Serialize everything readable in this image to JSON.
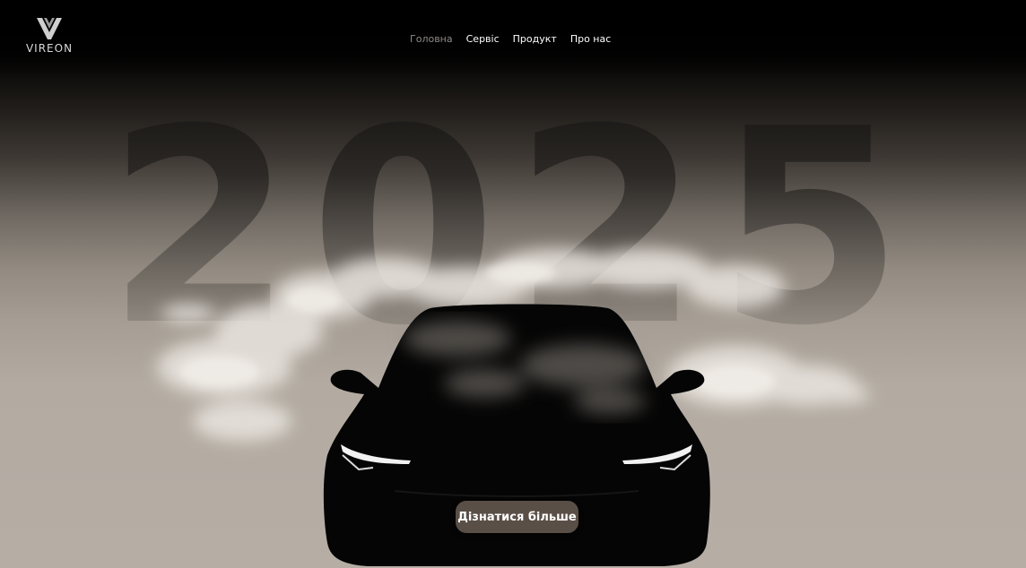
{
  "brand": {
    "name": "VIREON",
    "logo_icon": "v-logo-icon"
  },
  "nav": {
    "items": [
      {
        "label": "Головна",
        "active": true
      },
      {
        "label": "Сервіс",
        "active": false
      },
      {
        "label": "Продукт",
        "active": false
      },
      {
        "label": "Про нас",
        "active": false
      }
    ]
  },
  "hero": {
    "year": "2025",
    "cta_label": "Дізнатися більше"
  },
  "colors": {
    "background_top": "#000000",
    "background_bottom": "#b6aea5",
    "nav_active": "#8e8a86",
    "cta_background": "#5a4f47"
  }
}
